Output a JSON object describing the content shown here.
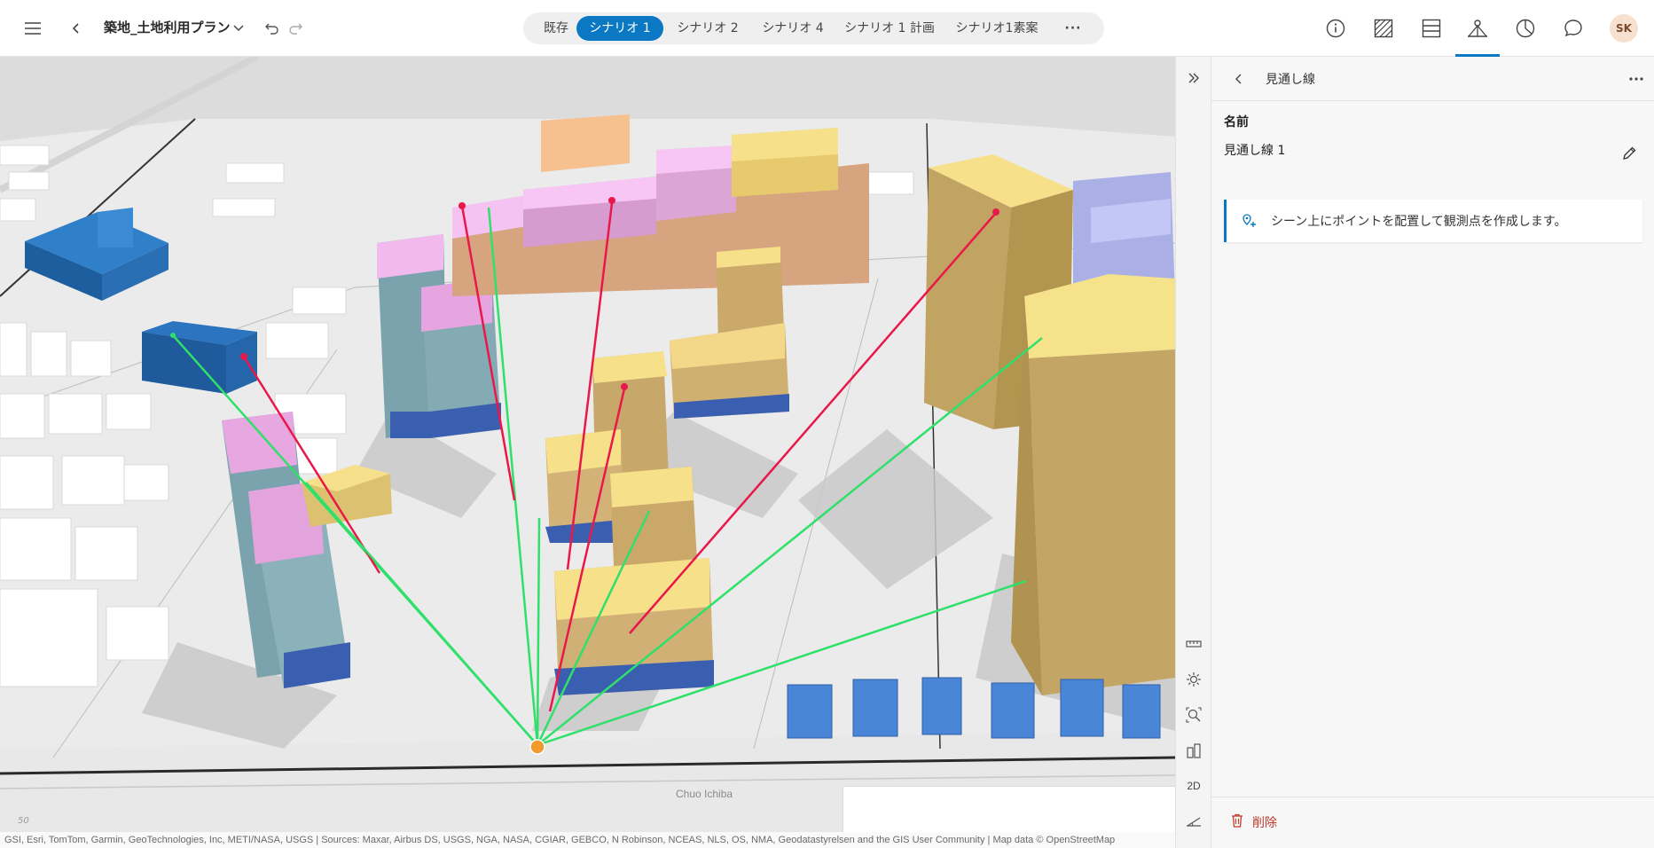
{
  "app": {
    "title": "築地_土地利用プラン"
  },
  "topbar": {
    "tabs": [
      {
        "label": "既存",
        "active": false
      },
      {
        "label": "シナリオ 1",
        "active": true
      },
      {
        "label": "シナリオ 2",
        "active": false
      },
      {
        "label": "シナリオ 4",
        "active": false
      },
      {
        "label": "シナリオ 1 計画",
        "active": false
      },
      {
        "label": "シナリオ1素案",
        "active": false
      }
    ],
    "more_glyph": "···",
    "right_icons": [
      "info-icon",
      "hatch-icon",
      "layers-icon",
      "line-of-sight-icon",
      "chart-icon",
      "comment-icon"
    ],
    "active_right_icon": "line-of-sight-icon",
    "user_initials": "SK"
  },
  "map": {
    "street_label": "Chuo Ichiba",
    "scale_label": "50",
    "attribution": "GSI, Esri, TomTom, Garmin, GeoTechnologies, Inc, METI/NASA, USGS | Sources: Maxar, Airbus DS, USGS, NGA, NASA, CGIAR, GEBCO, N Robinson, NCEAS, NLS, OS, NMA, Geodatastyrelsen and the GIS User Community | Map data © OpenStreetMap"
  },
  "toolstrip": {
    "label_2d": "2D",
    "tools": [
      "measure-icon",
      "daylight-icon",
      "zoom-to-icon",
      "building-explorer-icon",
      "slope-icon"
    ]
  },
  "panel": {
    "title": "見通し線",
    "name_label": "名前",
    "name_value": "見通し線 1",
    "notice": "シーン上にポイントを配置して観測点を作成します。",
    "delete_label": "削除"
  },
  "colors": {
    "accent": "#0a78c2",
    "visible_line": "#2fe06a",
    "blocked_line": "#e8194a",
    "delete": "#c0392b"
  }
}
